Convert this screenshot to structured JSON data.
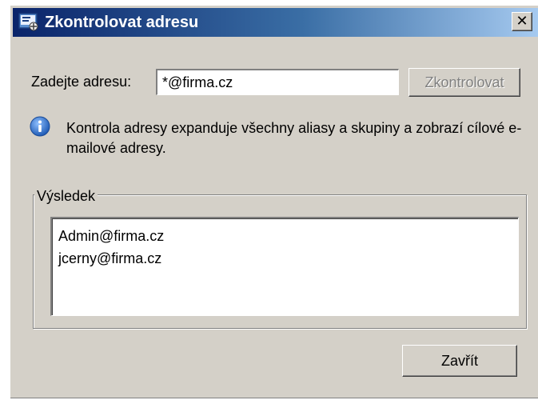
{
  "window": {
    "title": "Zkontrolovat adresu",
    "icon": "address-book-icon",
    "close_glyph": "✕"
  },
  "form": {
    "address_label": "Zadejte adresu:",
    "address_value": "*@firma.cz",
    "check_button_label": "Zkontrolovat"
  },
  "info": {
    "icon": "info-icon",
    "text": "Kontrola adresy expanduje všechny aliasy a skupiny a zobrazí cílové e-mailové adresy."
  },
  "result": {
    "group_label": "Výsledek",
    "items": [
      "Admin@firma.cz",
      "jcerny@firma.cz"
    ]
  },
  "footer": {
    "close_button_label": "Zavřít"
  },
  "colors": {
    "titlebar_start": "#0a246a",
    "titlebar_end": "#a6caf0",
    "dialog_face": "#d4d0c8",
    "info_blue": "#2f6fc8"
  }
}
